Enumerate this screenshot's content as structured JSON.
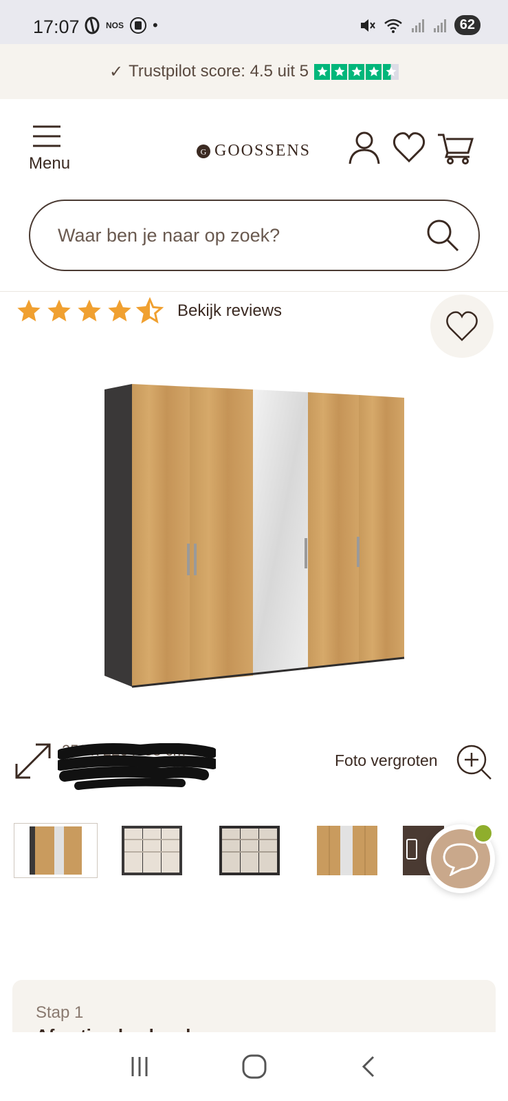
{
  "status_bar": {
    "time": "17:07",
    "carrier_badge": "NOS",
    "dot": "•",
    "battery": "62",
    "icons": [
      "vibrate-off-icon",
      "wifi-icon",
      "signal-icon",
      "signal-icon"
    ]
  },
  "trust_bar": {
    "check": "✓",
    "text": "Trustpilot score: 4.5 uit 5",
    "stars": 4.5,
    "star_color": "#00b67a"
  },
  "header": {
    "menu_label": "Menu",
    "logo_mark": "G",
    "logo_text": "GOOSSENS",
    "icons": [
      "account-icon",
      "heart-icon",
      "cart-icon"
    ]
  },
  "search": {
    "placeholder": "Waar ben je naar op zoek?"
  },
  "product": {
    "rating": 4.5,
    "rating_color": "#f0a030",
    "reviews_link": "Bekijk reviews",
    "dimensions_partial": "250 x 220 x 58 cm",
    "zoom_label": "Foto vergroten",
    "thumbnails": [
      "wardrobe-front",
      "wardrobe-open-grey",
      "wardrobe-open-dark",
      "wardrobe-mirror",
      "wardrobe-detail"
    ]
  },
  "step": {
    "label": "Stap 1",
    "title": "Afmeting b x h x d"
  },
  "colors": {
    "brand": "#3b2a22",
    "cream": "#f6f3ee",
    "chat": "#c9a88b",
    "online_dot": "#8fae2c"
  }
}
